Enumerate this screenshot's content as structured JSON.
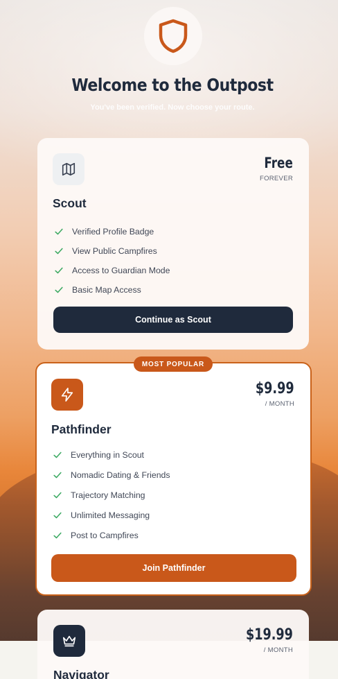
{
  "header": {
    "logo_icon": "shield-icon",
    "title": "Welcome to the Outpost",
    "subtitle": "You've been verified. Now choose your route."
  },
  "plans": [
    {
      "id": "scout",
      "icon": "map-icon",
      "name": "Scout",
      "price": "Free",
      "period": "FOREVER",
      "features": [
        "Verified Profile Badge",
        "View Public Campfires",
        "Access to Guardian Mode",
        "Basic Map Access"
      ],
      "cta": "Continue as Scout"
    },
    {
      "id": "pathfinder",
      "icon": "lightning-icon",
      "badge": "MOST POPULAR",
      "name": "Pathfinder",
      "price": "$9.99",
      "period": "/ MONTH",
      "features": [
        "Everything in Scout",
        "Nomadic Dating & Friends",
        "Trajectory Matching",
        "Unlimited Messaging",
        "Post to Campfires"
      ],
      "cta": "Join Pathfinder"
    },
    {
      "id": "navigator",
      "icon": "crown-icon",
      "name": "Navigator",
      "price": "$19.99",
      "period": "/ MONTH"
    }
  ],
  "colors": {
    "accent": "#c9581a",
    "dark": "#1f2a3c",
    "check": "#3daa63"
  }
}
